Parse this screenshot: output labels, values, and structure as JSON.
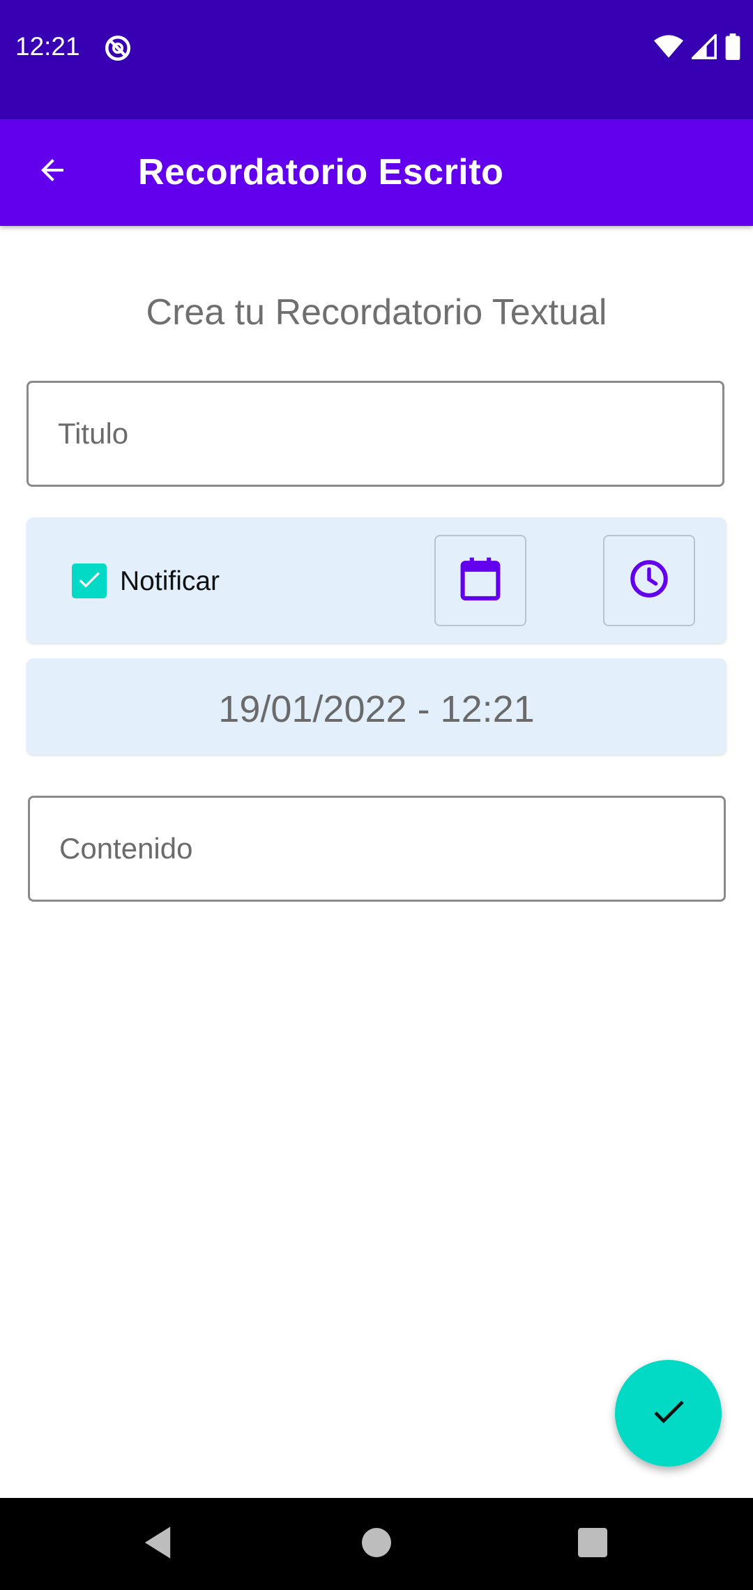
{
  "status_bar": {
    "time": "12:21",
    "icons": [
      "do-not-disturb-icon",
      "wifi-icon",
      "cell-signal-icon",
      "battery-icon"
    ]
  },
  "app_bar": {
    "title": "Recordatorio Escrito",
    "back_icon": "arrow-back-icon"
  },
  "form": {
    "heading": "Crea tu Recordatorio Textual",
    "title_placeholder": "Titulo",
    "notify": {
      "label": "Notificar",
      "checked": true
    },
    "calendar_icon": "calendar-icon",
    "clock_icon": "clock-icon",
    "datetime": "19/01/2022 - 12:21",
    "content_placeholder": "Contenido"
  },
  "fab": {
    "icon": "check-icon"
  },
  "nav_bar": {
    "icons": [
      "nav-back-icon",
      "nav-home-icon",
      "nav-recents-icon"
    ]
  },
  "colors": {
    "status_bar": "#3700b3",
    "app_bar": "#6200ee",
    "accent": "#03dac5",
    "card_bg": "#e3f0fb"
  }
}
